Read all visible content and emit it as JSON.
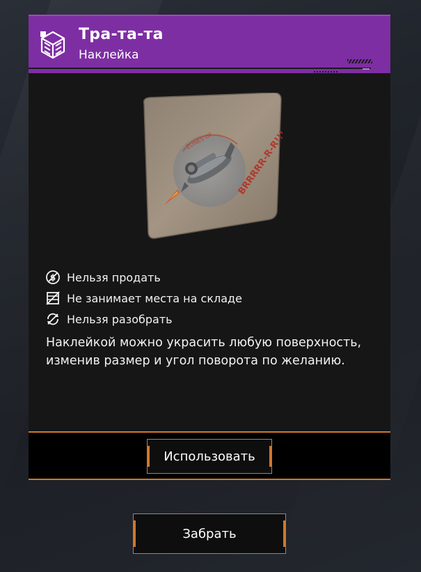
{
  "item": {
    "title": "Тра-та-та",
    "subtitle": "Наклейка",
    "rarity_color": "#7e2ea3",
    "category_icon": "sticker-cube-icon",
    "image": {
      "name": "sticker-image",
      "sticker_text": "BRRRRR-R-R!!!",
      "arc_text": "ZONES OF"
    }
  },
  "properties": [
    {
      "icon": "no-sell-icon",
      "label": "Нельзя продать"
    },
    {
      "icon": "no-storage-icon",
      "label": "Не занимает места на складе"
    },
    {
      "icon": "no-disassemble-icon",
      "label": "Нельзя разобрать"
    }
  ],
  "description": "Наклейкой можно украсить любую поверхность, изменив размер и угол поворота по желанию.",
  "buttons": {
    "use": "Использовать",
    "take": "Забрать"
  },
  "colors": {
    "accent": "#d0782a",
    "card_bg": "#161616",
    "footer_bg": "#000000"
  }
}
